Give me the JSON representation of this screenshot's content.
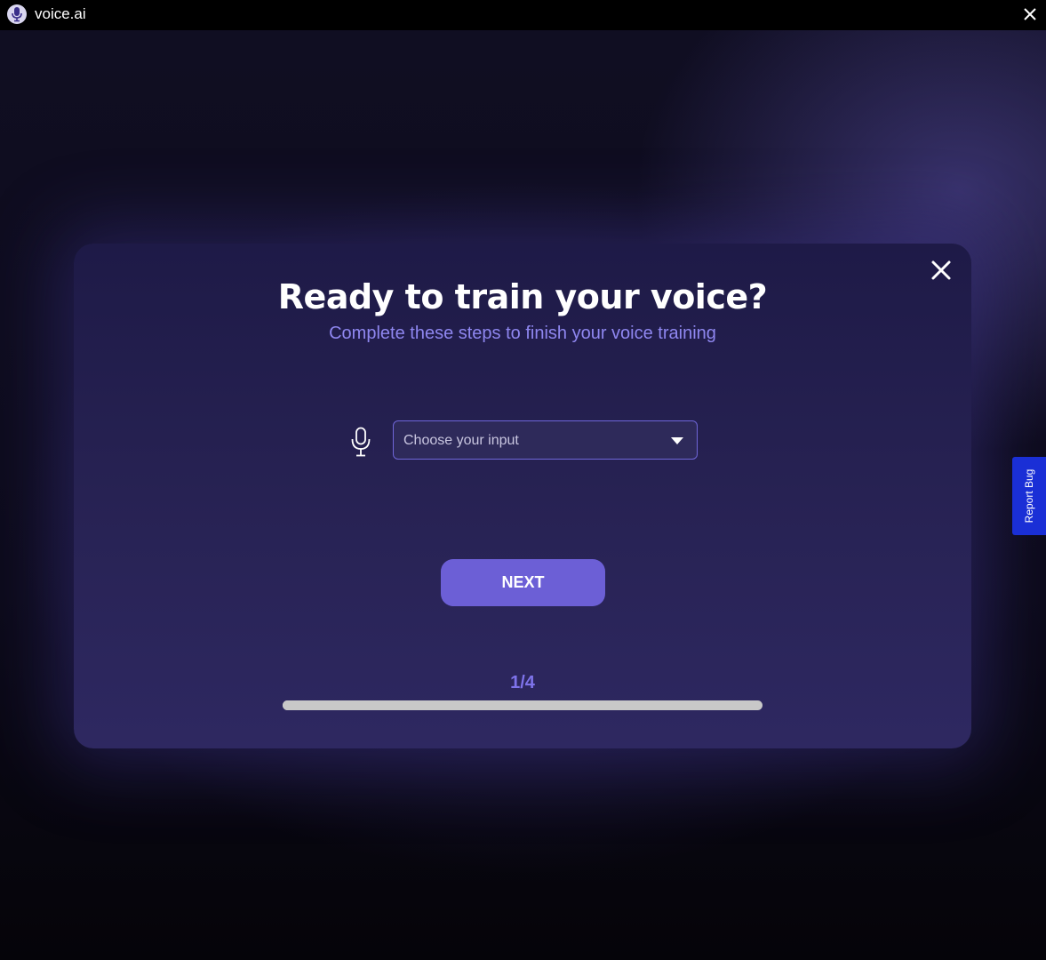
{
  "window": {
    "title": "voice.ai",
    "logo_icon": "microphone-logo-icon",
    "close_icon": "close-icon"
  },
  "modal": {
    "title": "Ready to train your voice?",
    "subtitle": "Complete these steps to finish your voice training",
    "close_icon": "close-icon",
    "input": {
      "icon": "microphone-icon",
      "placeholder": "Choose your input",
      "value": "",
      "dropdown_icon": "chevron-down-icon"
    },
    "next_label": "NEXT",
    "step": {
      "label": "1/4",
      "current": 1,
      "total": 4
    }
  },
  "report_bug": {
    "label": "Report Bug"
  },
  "colors": {
    "accent": "#6c5fd6",
    "subtitle": "#8f87f0",
    "step_counter": "#7e73ea",
    "report_bug_bg": "#1a2fd6",
    "modal_bg": "#272253"
  }
}
